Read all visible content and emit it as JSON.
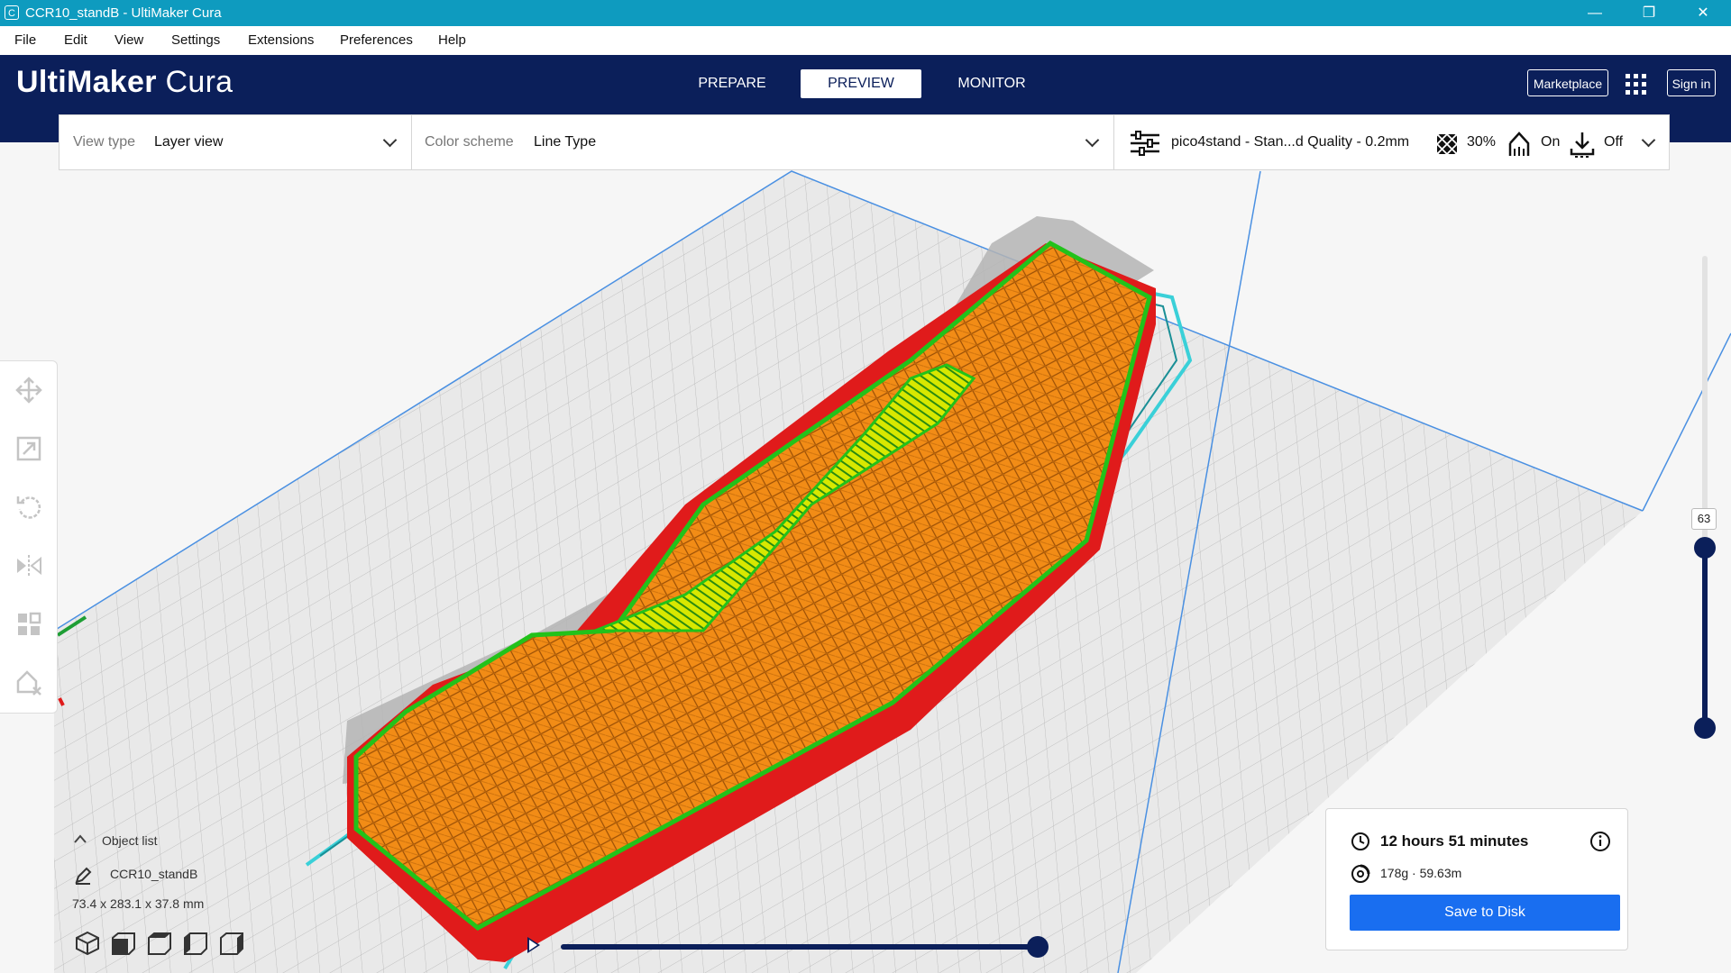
{
  "window": {
    "title": "CCR10_standB - UltiMaker Cura",
    "app_icon_letter": "C",
    "minimize": "—",
    "restore": "❐",
    "close": "✕"
  },
  "menu": [
    "File",
    "Edit",
    "View",
    "Settings",
    "Extensions",
    "Preferences",
    "Help"
  ],
  "header": {
    "logo_bold": "UltiMaker",
    "logo_light": "Cura",
    "stages": [
      {
        "label": "PREPARE",
        "active": false
      },
      {
        "label": "PREVIEW",
        "active": true
      },
      {
        "label": "MONITOR",
        "active": false
      }
    ],
    "marketplace": "Marketplace",
    "sign_in": "Sign in"
  },
  "view_type": {
    "label": "View type",
    "value": "Layer view"
  },
  "color_scheme": {
    "label": "Color scheme",
    "value": "Line Type"
  },
  "print_setup": {
    "profile": "pico4stand - Stan...d Quality - 0.2mm",
    "infill": "30%",
    "support": "On",
    "adhesion": "Off"
  },
  "left_tools": [
    "move-icon",
    "scale-icon",
    "rotate-icon",
    "mirror-icon",
    "per-model-settings-icon",
    "support-blocker-icon"
  ],
  "object_list": {
    "header": "Object list",
    "object_name": "CCR10_standB",
    "dimensions": "73.4 x 283.1 x 37.8 mm"
  },
  "camera_views": [
    "3d-view-icon",
    "front-view-icon",
    "top-view-icon",
    "left-view-icon",
    "right-view-icon"
  ],
  "layer_slider": {
    "current_layer": "63"
  },
  "simulation": {
    "progress": 1.0
  },
  "print_info": {
    "time": "12 hours 51 minutes",
    "material": "178g · 59.63m",
    "save_button": "Save to Disk"
  },
  "colors": {
    "header_bg": "#0b1f5a",
    "titlebar_bg": "#0e9bbf",
    "accent_blue": "#196ef0",
    "wall_red": "#e01b1b",
    "infill_orange": "#f28c16",
    "skin_yellow": "#f5e600",
    "inner_wall_green": "#22c21a",
    "skirt_cyan": "#3ad0d8",
    "support_gray": "#b4b4b4"
  }
}
